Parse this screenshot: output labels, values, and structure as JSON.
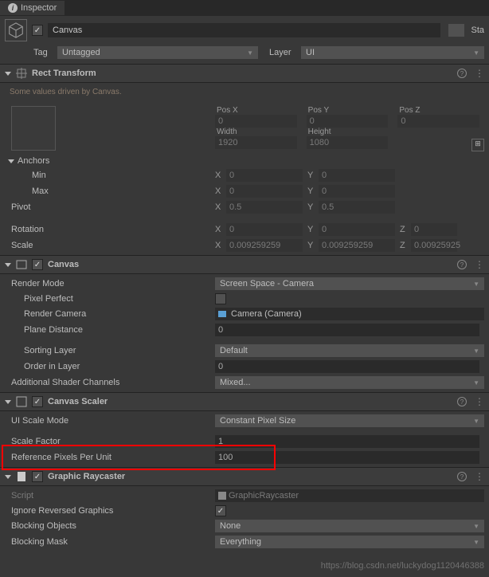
{
  "tab": {
    "title": "Inspector"
  },
  "header": {
    "name": "Canvas",
    "static_label": "Sta",
    "tag_label": "Tag",
    "tag_value": "Untagged",
    "layer_label": "Layer",
    "layer_value": "UI"
  },
  "rect_transform": {
    "title": "Rect Transform",
    "driven_note": "Some values driven by Canvas.",
    "cols": {
      "posx": "Pos X",
      "posy": "Pos Y",
      "posz": "Pos Z",
      "width": "Width",
      "height": "Height"
    },
    "posx": "0",
    "posy": "0",
    "posz": "0",
    "width": "1920",
    "height": "1080",
    "anchors_label": "Anchors",
    "min_label": "Min",
    "min_x": "0",
    "min_y": "0",
    "max_label": "Max",
    "max_x": "0",
    "max_y": "0",
    "pivot_label": "Pivot",
    "pivot_x": "0.5",
    "pivot_y": "0.5",
    "rotation_label": "Rotation",
    "rot_x": "0",
    "rot_y": "0",
    "rot_z": "0",
    "scale_label": "Scale",
    "scale_x": "0.009259259",
    "scale_y": "0.009259259",
    "scale_z": "0.00925925"
  },
  "canvas": {
    "title": "Canvas",
    "render_mode_label": "Render Mode",
    "render_mode_value": "Screen Space - Camera",
    "pixel_perfect_label": "Pixel Perfect",
    "render_camera_label": "Render Camera",
    "render_camera_value": "Camera (Camera)",
    "plane_distance_label": "Plane Distance",
    "plane_distance_value": "0",
    "sorting_layer_label": "Sorting Layer",
    "sorting_layer_value": "Default",
    "order_label": "Order in Layer",
    "order_value": "0",
    "shader_label": "Additional Shader Channels",
    "shader_value": "Mixed..."
  },
  "canvas_scaler": {
    "title": "Canvas Scaler",
    "ui_scale_label": "UI Scale Mode",
    "ui_scale_value": "Constant Pixel Size",
    "scale_factor_label": "Scale Factor",
    "scale_factor_value": "1",
    "rppu_label": "Reference Pixels Per Unit",
    "rppu_value": "100"
  },
  "graphic_raycaster": {
    "title": "Graphic Raycaster",
    "script_label": "Script",
    "script_value": "GraphicRaycaster",
    "ignore_label": "Ignore Reversed Graphics",
    "blocking_obj_label": "Blocking Objects",
    "blocking_obj_value": "None",
    "blocking_mask_label": "Blocking Mask",
    "blocking_mask_value": "Everything"
  },
  "axis": {
    "x": "X",
    "y": "Y",
    "z": "Z"
  },
  "watermark": "https://blog.csdn.net/luckydog1120446388"
}
